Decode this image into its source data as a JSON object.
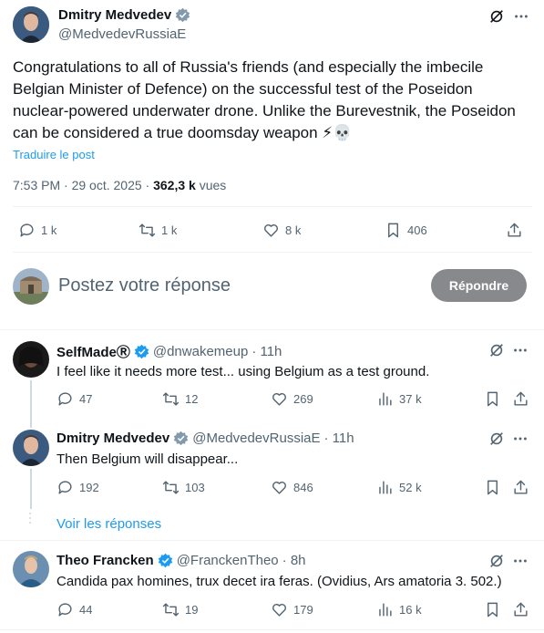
{
  "main_tweet": {
    "author_name": "Dmitry Medvedev",
    "author_handle": "@MedvedevRussiaE",
    "text": "Congratulations to all of Russia's friends (and especially the imbecile Belgian Minister of Defence) on the successful test of the Poseidon nuclear-powered underwater drone. Unlike the Burevestnik, the Poseidon can be considered a true doomsday weapon",
    "emoji": "⚡💀",
    "translate_link": "Traduire le post",
    "time": "7:53 PM · 29 oct. 2025 · ",
    "views_count": "362,3 k",
    "views_label": " vues",
    "replies": "1 k",
    "reposts": "1 k",
    "likes": "8 k",
    "bookmarks": "406"
  },
  "reply_box": {
    "placeholder": "Postez votre réponse",
    "button_label": "Répondre"
  },
  "replies": [
    {
      "author_name": "SelfMadeⓇ",
      "author_handle": "@dnwakemeup",
      "time": "· 11h",
      "text": "I feel like it needs more test... using Belgium as a test ground.",
      "replies": "47",
      "reposts": "12",
      "likes": "269",
      "views": "37 k"
    },
    {
      "author_name": "Dmitry Medvedev",
      "author_handle": "@MedvedevRussiaE",
      "time": "· 11h",
      "text": "Then Belgium will disappear...",
      "replies": "192",
      "reposts": "103",
      "likes": "846",
      "views": "52 k"
    },
    {
      "author_name": "Theo Francken",
      "author_handle": "@FranckenTheo",
      "time": "· 8h",
      "text": "Candida pax homines, trux decet ira feras. (Ovidius, Ars amatoria 3. 502.)",
      "replies": "44",
      "reposts": "19",
      "likes": "179",
      "views": "16 k"
    }
  ],
  "show_replies_link": "Voir les réponses",
  "colors": {
    "accent": "#1d9bf0",
    "muted": "#536471",
    "text": "#0f1419",
    "button_disabled": "#87898c"
  }
}
